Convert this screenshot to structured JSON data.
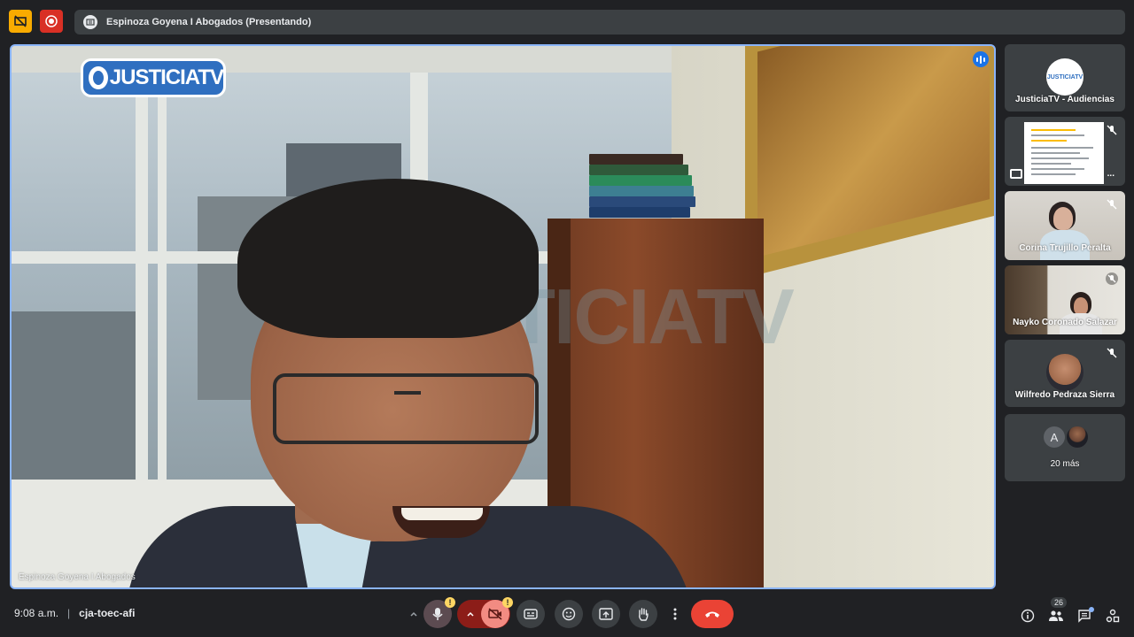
{
  "topbar": {
    "presenting_title": "Espinoza Goyena I Abogados (Presentando)",
    "icons": [
      "presentation-off-icon",
      "record-icon",
      "present-screen-icon"
    ]
  },
  "main_video": {
    "participant_name": "Espinoza Goyena I Abogados",
    "logo_text": "JUSTICIATV",
    "watermark_text": "JUSTICIATV",
    "speaking_indicator": "voice-activity-icon"
  },
  "participants": [
    {
      "name": "JusticiaTV - Audiencias",
      "logo_text": "JUSTICIATV"
    },
    {
      "name": "",
      "more_label": "..."
    },
    {
      "name": "Corina Trujillo Peralta",
      "muted": true
    },
    {
      "name": "Nayko Coronado Salazar",
      "muted": true
    },
    {
      "name": "Wilfredo Pedraza Sierra",
      "muted": true
    },
    {
      "name": "20 más",
      "avatar_letter": "A"
    }
  ],
  "bottombar": {
    "time": "9:08 a.m.",
    "meeting_code": "cja-toec-afi",
    "warning_mark": "!",
    "participant_count": "26"
  },
  "colors": {
    "accent_blue": "#8ab4f8",
    "hangup_red": "#ea4335",
    "background": "#202124",
    "warning_yellow": "#fdd663"
  }
}
